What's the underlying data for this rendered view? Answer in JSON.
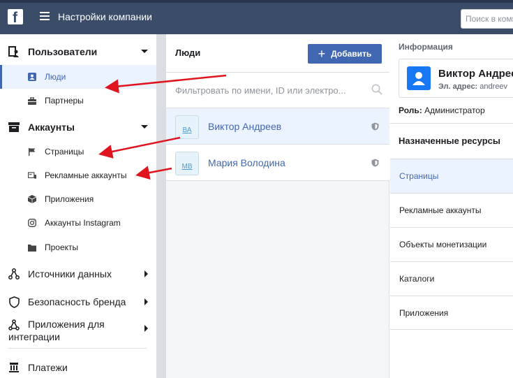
{
  "topbar": {
    "logo": "f",
    "title": "Настройки компании",
    "search_placeholder": "Поиск в компании"
  },
  "sidebar": {
    "users": {
      "label": "Пользователи",
      "items": [
        {
          "label": "Люди",
          "icon": "person-icon"
        },
        {
          "label": "Партнеры",
          "icon": "briefcase-icon"
        }
      ]
    },
    "accounts": {
      "label": "Аккаунты",
      "items": [
        {
          "label": "Страницы",
          "icon": "flag-icon"
        },
        {
          "label": "Рекламные аккаунты",
          "icon": "ad-account-icon"
        },
        {
          "label": "Приложения",
          "icon": "cube-icon"
        },
        {
          "label": "Аккаунты Instagram",
          "icon": "instagram-icon"
        },
        {
          "label": "Проекты",
          "icon": "folder-icon"
        }
      ]
    },
    "sections": [
      {
        "label": "Источники данных",
        "icon": "data-sources-icon"
      },
      {
        "label": "Безопасность бренда",
        "icon": "shield-icon"
      },
      {
        "label": "Приложения для интеграции",
        "icon": "integrations-icon"
      },
      {
        "label": "Платежи",
        "icon": "payments-icon"
      }
    ]
  },
  "people": {
    "title": "Люди",
    "add_label": "Добавить",
    "filter_placeholder": "Фильтровать по имени, ID или электро...",
    "list": [
      {
        "initials": "ВА",
        "name": "Виктор Андреев"
      },
      {
        "initials": "МВ",
        "name": "Мария Володина"
      }
    ]
  },
  "info": {
    "label": "Информация",
    "name": "Виктор Андреев",
    "email_label": "Эл. адрес:",
    "email": "andreev",
    "role_label": "Роль:",
    "role": "Администратор",
    "resources_title": "Назначенные ресурсы",
    "resources": [
      {
        "label": "Страницы"
      },
      {
        "label": "Рекламные аккаунты"
      },
      {
        "label": "Объекты монетизации"
      },
      {
        "label": "Каталоги"
      },
      {
        "label": "Приложения"
      }
    ]
  },
  "colors": {
    "topbar": "#3b4c69",
    "accent": "#4267b2",
    "arrow": "#e0141e"
  }
}
